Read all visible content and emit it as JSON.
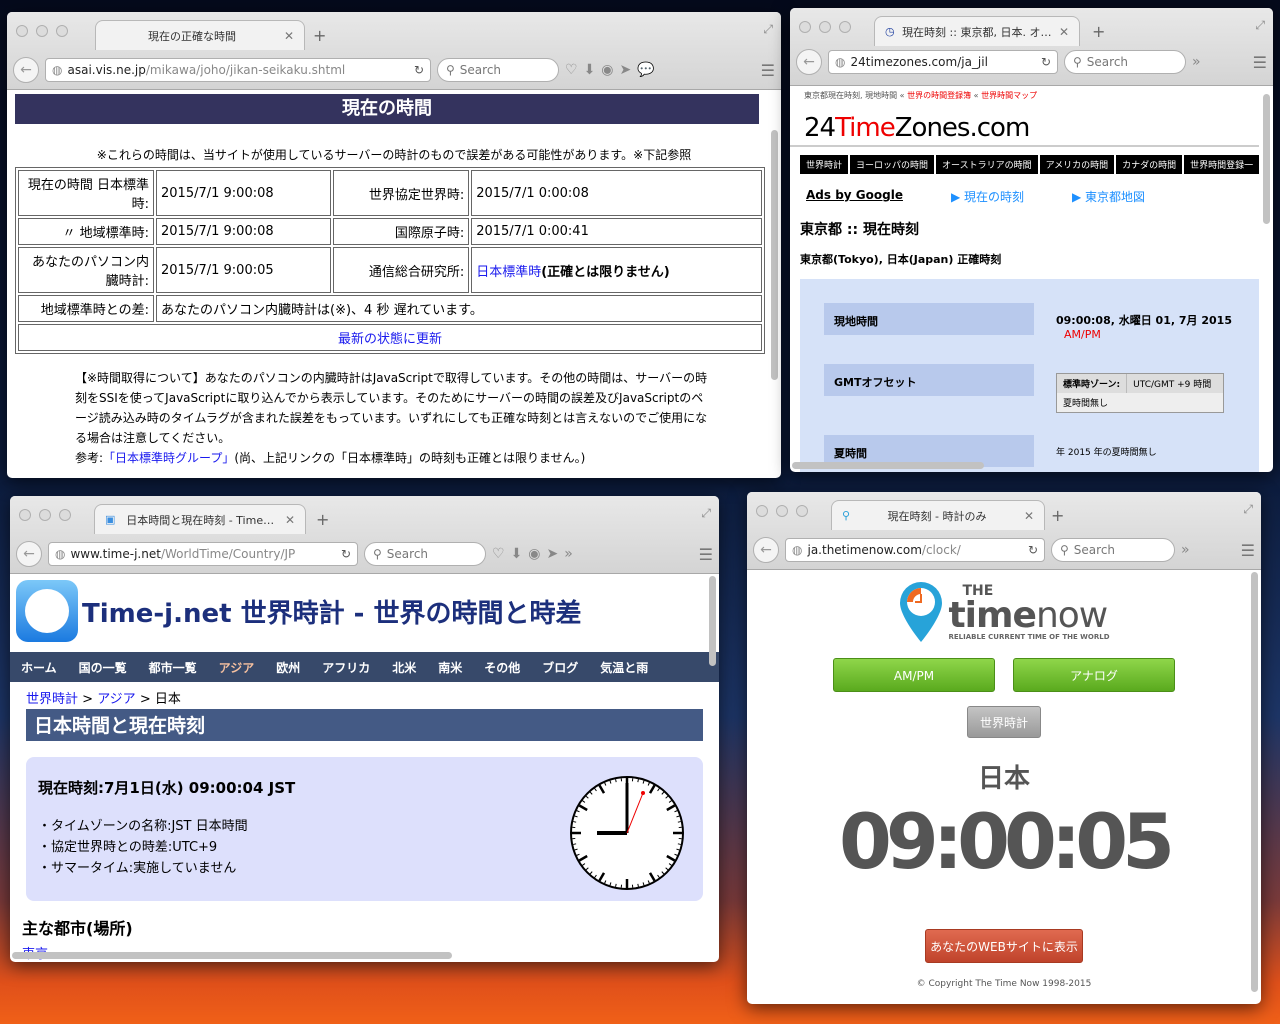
{
  "w1": {
    "tab": "現在の正確な時間",
    "url_host": "asai.vis.ne.jp",
    "url_path": "/mikawa/joho/jikan-seikaku.shtml",
    "search": "Search",
    "heading": "現在の時間",
    "note": "※これらの時間は、当サイトが使用しているサーバーの時計のもので誤差がある可能性があります。※下記参照",
    "rows": [
      {
        "l1": "現在の時間 日本標準時:",
        "v1": "2015/7/1 9:00:08",
        "l2": "世界協定世界時:",
        "v2": "2015/7/1 0:00:08"
      },
      {
        "l1": "〃 地域標準時:",
        "v1": "2015/7/1 9:00:08",
        "l2": "国際原子時:",
        "v2": "2015/7/1 0:00:41"
      },
      {
        "l1": "あなたのパソコン内臓時計:",
        "v1": "2015/7/1 9:00:05",
        "l2": "通信総合研究所:",
        "v2link": "日本標準時",
        "v2": "(正確とは限りません)"
      }
    ],
    "diff_label": "地域標準時との差:",
    "diff_value": "あなたのパソコン内臓時計は(※)、4 秒 遅れています。",
    "refresh": "最新の状態に更新",
    "para": "【※時間取得について】あなたのパソコンの内臓時計はJavaScriptで取得しています。その他の時間は、サーバーの時刻をSSIを使ってJavaScriptに取り込んでから表示しています。そのためにサーバーの時間の誤差及びJavaScriptのページ読み込み時のタイムラグが含まれた誤差をもっています。いずれにしても正確な時刻とは言えないのでご使用になる場合は注意してください。",
    "ref_prefix": "参考:",
    "ref_link": "「日本標準時グループ」",
    "ref_suffix": "(尚、上記リンクの「日本標準時」の時刻も正確とは限りません。)"
  },
  "w2": {
    "tab": "現在時刻 :: 東京都, 日本. オ…",
    "url": "24timezones.com/ja_jil",
    "search": "Search",
    "top_text": "東京都現在時刻, 現地時間 «",
    "top_link1": "世界の時間登録簿",
    "top_sep": "«",
    "top_link2": "世界時間マップ",
    "logo_a": "24",
    "logo_b": "Time",
    "logo_c": "Zones.com",
    "nav": [
      "世界時計",
      "ヨーロッパの時間",
      "オーストラリアの時間",
      "アメリカの時間",
      "カナダの時間",
      "世界時間登録一"
    ],
    "ads": "Ads by Google",
    "link1": "▶ 現在の時刻",
    "link2": "▶ 東京都地図",
    "heading": "東京都 :: 現在時刻",
    "sub": "東京都(Tokyo), 日本(Japan) 正確時刻",
    "local_label": "現地時間",
    "local_value": "09:00:08, 水曜日 01, 7月 2015",
    "ampm": "AM/PM",
    "gmt_label": "GMTオフセット",
    "zone_label": "標準時ゾーン:",
    "zone_value": "UTC/GMT +9 時間",
    "no_dst": "夏時間無し",
    "dst_label": "夏時間",
    "dst_value": "年 2015 年の夏時間無し"
  },
  "w3": {
    "tab": "日本時間と現在時刻 - Time…",
    "url_host": "www.time-j.net",
    "url_path": "/WorldTime/Country/JP",
    "search": "Search",
    "title": "Time-j.net 世界時計 - 世界の時間と時差",
    "nav": [
      "ホーム",
      "国の一覧",
      "都市一覧",
      "アジア",
      "欧州",
      "アフリカ",
      "北米",
      "南米",
      "その他",
      "ブログ",
      "気温と雨"
    ],
    "crumb1": "世界時計",
    "crumb2": "アジア",
    "crumb3": "日本",
    "sep": ">",
    "heading": "日本時間と現在時刻",
    "now": "現在時刻:7月1日(水) 09:00:04 JST",
    "info": [
      "・タイムゾーンの名称:JST 日本時間",
      "・協定世界時との時差:UTC+9",
      "・サマータイム:実施していません"
    ],
    "cities_heading": "主な都市(場所)",
    "city": "東京"
  },
  "w4": {
    "tab": "現在時刻 - 時計のみ",
    "url_host": "ja.thetimenow.com",
    "url_path": "/clock/",
    "search": "Search",
    "logo_the": "THE",
    "logo_time": "time",
    "logo_now": "now",
    "tagline": "RELIABLE CURRENT TIME OF THE WORLD",
    "btn_ampm": "AM/PM",
    "btn_analog": "アナログ",
    "btn_world": "世界時計",
    "country": "日本",
    "time": "09:00:05",
    "btn_embed": "あなたのWEBサイトに表示",
    "copyright": "© Copyright The Time Now 1998-2015"
  }
}
